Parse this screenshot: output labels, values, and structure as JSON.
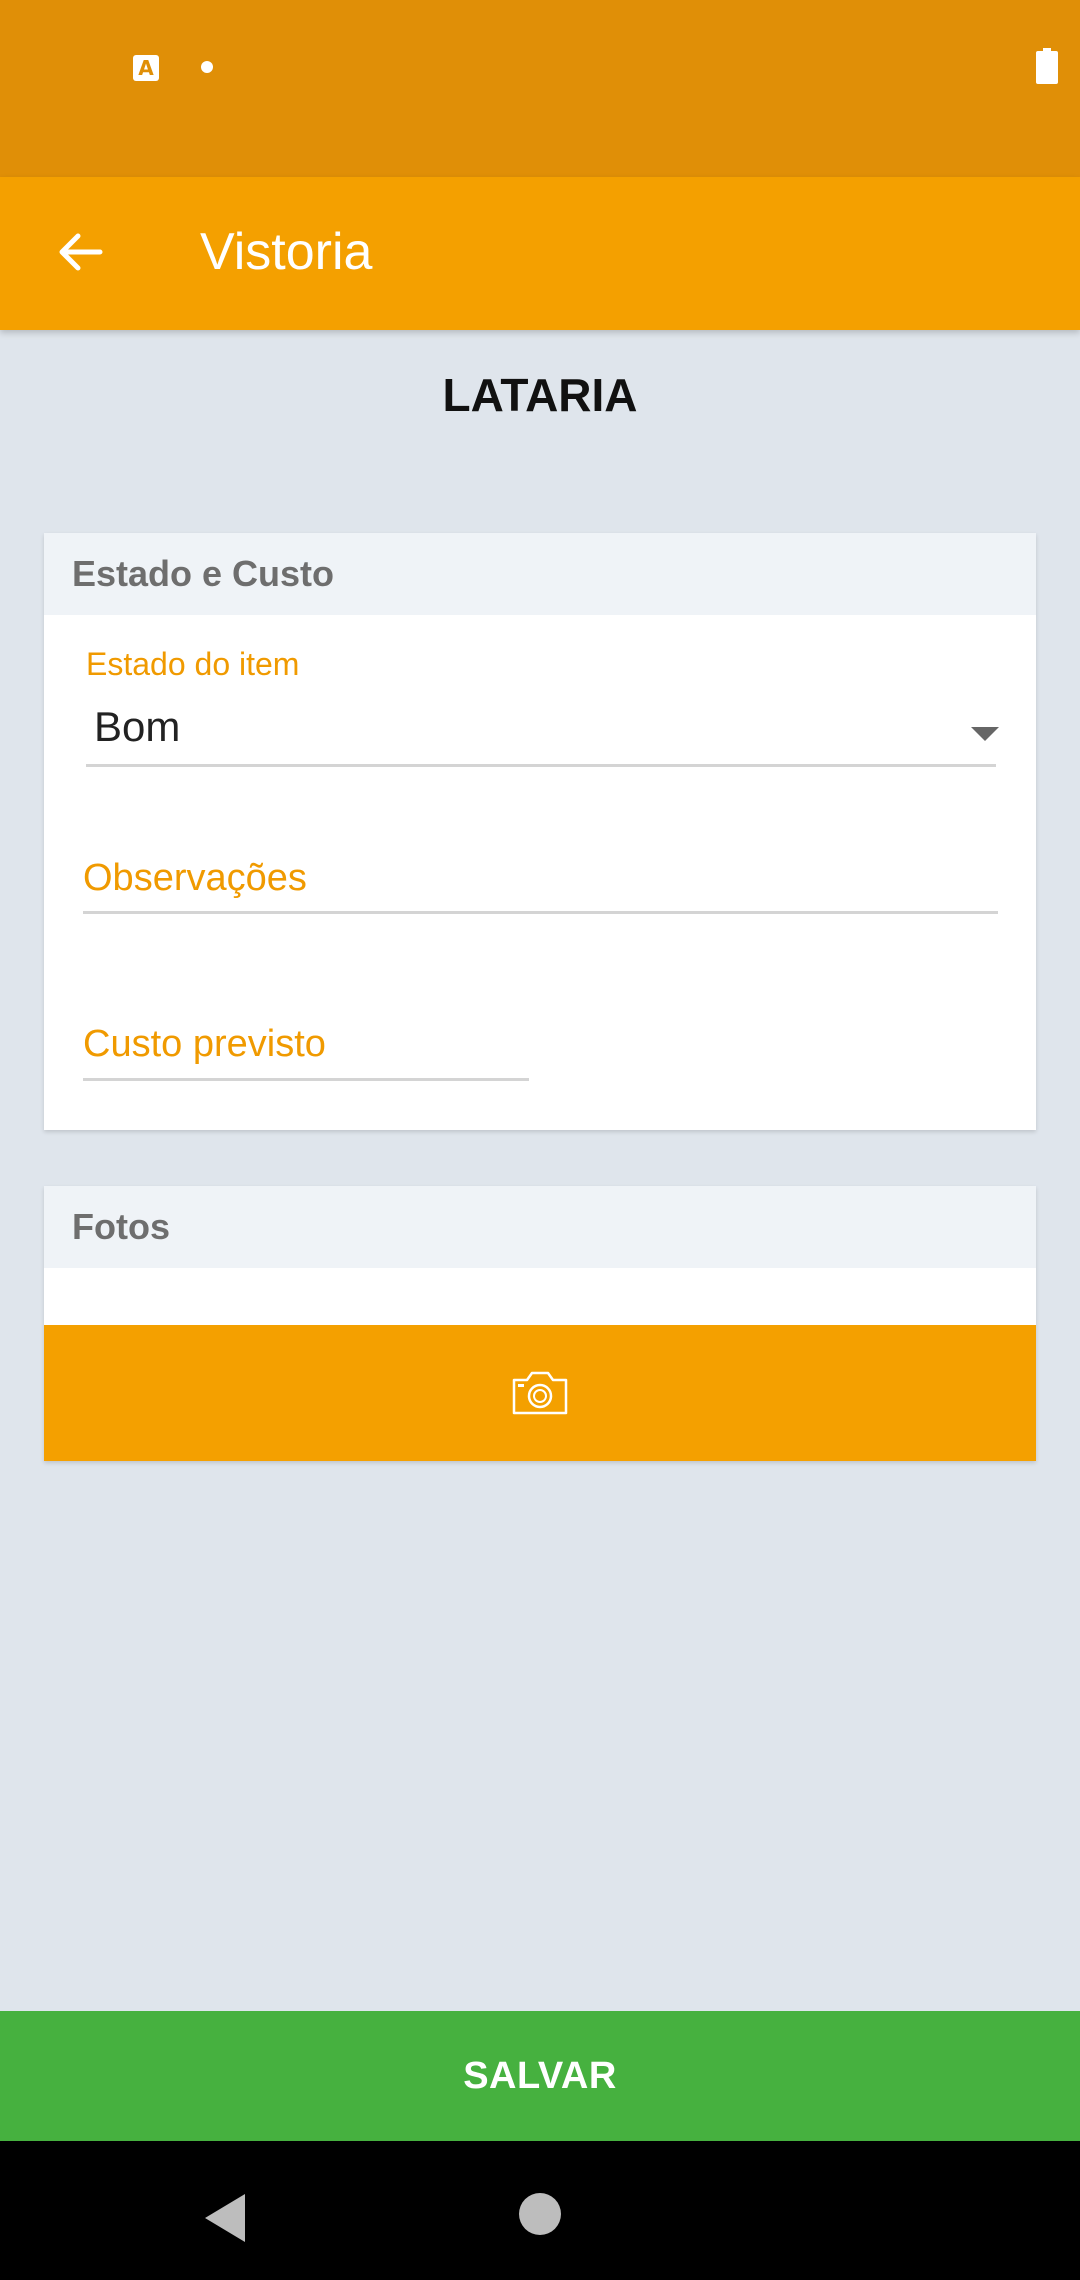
{
  "status_bar": {
    "notification_icon": "a-badge-icon",
    "dot_icon": "dot-icon",
    "battery_icon": "battery-icon",
    "notification_letter": "A"
  },
  "app_bar": {
    "back_icon": "arrow-back-icon",
    "title": "Vistoria"
  },
  "page": {
    "title": "LATARIA"
  },
  "estado_card": {
    "header": "Estado e Custo",
    "estado_label": "Estado do item",
    "estado_value": "Bom",
    "observacoes_placeholder": "Observações",
    "custo_placeholder": "Custo previsto"
  },
  "fotos_card": {
    "header": "Fotos",
    "camera_icon": "camera-icon"
  },
  "footer": {
    "save_label": "SALVAR"
  },
  "nav_bar": {
    "back_icon": "nav-back-icon",
    "home_icon": "nav-home-icon"
  },
  "colors": {
    "status_bar": "#e08f07",
    "app_bar": "#f4a000",
    "accent": "#f09a00",
    "save": "#46b13f",
    "background": "#dfe5ec"
  }
}
